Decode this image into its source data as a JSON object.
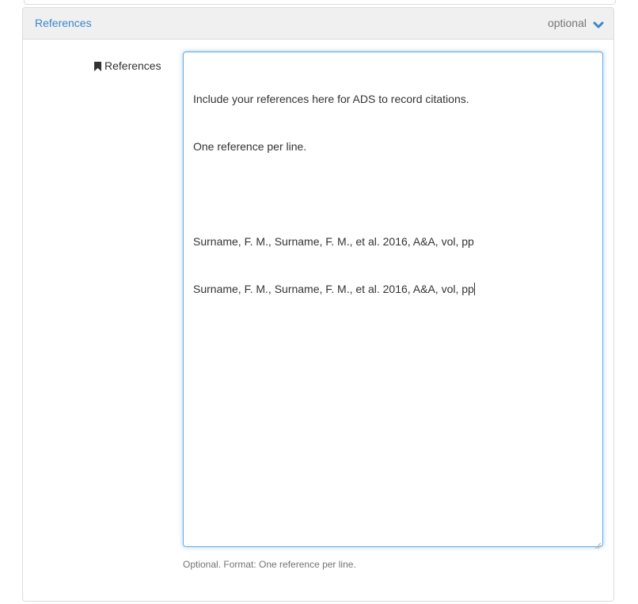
{
  "panel": {
    "title": "References",
    "status": "optional",
    "chevron_icon": "chevron-down-icon",
    "accent_color": "#3a87c8"
  },
  "field": {
    "label": "References",
    "label_icon": "bookmark-icon",
    "lines": [
      "Include your references here for ADS to record citations.",
      "One reference per line.",
      "",
      "Surname, F. M., Surname, F. M., et al. 2016, A&A, vol, pp",
      "Surname, F. M., Surname, F. M., et al. 2016, A&A, vol, pp"
    ],
    "help": "Optional. Format: One reference per line."
  }
}
